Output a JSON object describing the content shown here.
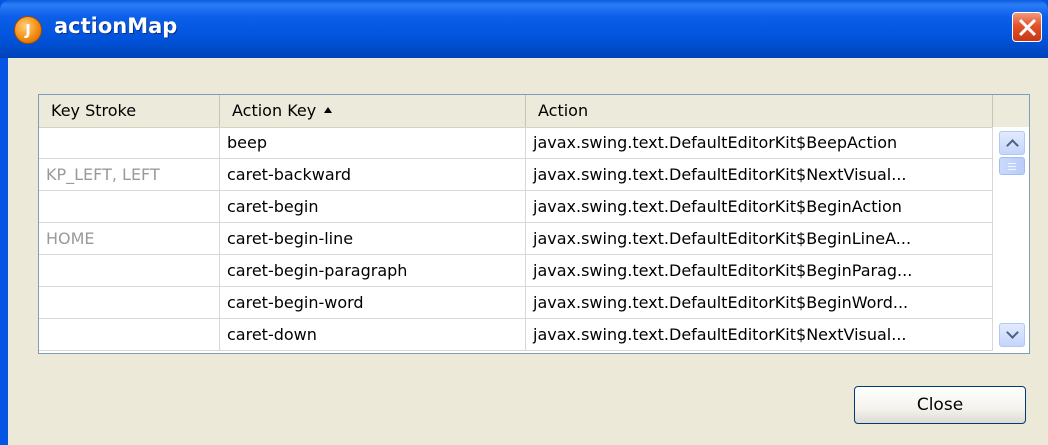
{
  "window": {
    "title": "actionMap",
    "app_icon_glyph": "J"
  },
  "table": {
    "columns": [
      {
        "label": "Key Stroke"
      },
      {
        "label": "Action Key",
        "sort_indicator": "ascending"
      },
      {
        "label": "Action"
      }
    ],
    "rows": [
      {
        "key_stroke": "",
        "action_key": "beep",
        "action": "javax.swing.text.DefaultEditorKit$BeepAction"
      },
      {
        "key_stroke": "KP_LEFT, LEFT",
        "action_key": "caret-backward",
        "action": "javax.swing.text.DefaultEditorKit$NextVisual..."
      },
      {
        "key_stroke": "",
        "action_key": "caret-begin",
        "action": "javax.swing.text.DefaultEditorKit$BeginAction"
      },
      {
        "key_stroke": "HOME",
        "action_key": "caret-begin-line",
        "action": "javax.swing.text.DefaultEditorKit$BeginLineA..."
      },
      {
        "key_stroke": "",
        "action_key": "caret-begin-paragraph",
        "action": "javax.swing.text.DefaultEditorKit$BeginParag..."
      },
      {
        "key_stroke": "",
        "action_key": "caret-begin-word",
        "action": "javax.swing.text.DefaultEditorKit$BeginWord..."
      },
      {
        "key_stroke": "",
        "action_key": "caret-down",
        "action": "javax.swing.text.DefaultEditorKit$NextVisual..."
      }
    ]
  },
  "buttons": {
    "close_label": "Close"
  },
  "colors": {
    "title_bar": "#0554e3",
    "dialog_background": "#ece9d8",
    "key_stroke_text": "#9a9a9a",
    "close_x": "#e3532b"
  }
}
